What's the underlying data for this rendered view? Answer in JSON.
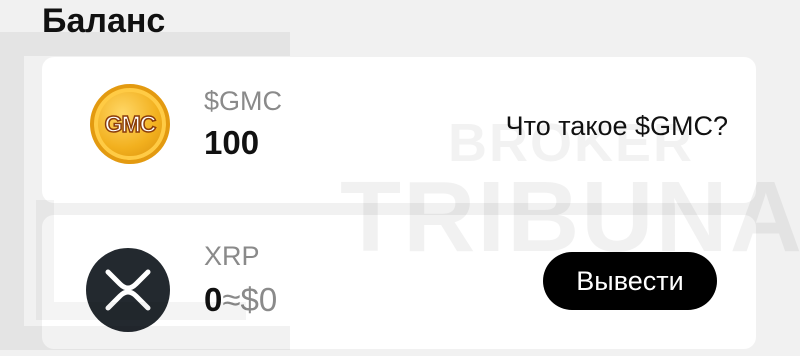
{
  "balance": {
    "title": "Баланс"
  },
  "coins": [
    {
      "icon": "gmc-coin-icon",
      "icon_text": "GMC",
      "name": "$GMC",
      "amount": "100",
      "link_label": "Что такое $GMC?"
    },
    {
      "icon": "xrp-coin-icon",
      "name": "XRP",
      "amount": "0",
      "fiat_value": "≈$0",
      "button_label": "Вывести"
    }
  ],
  "watermark": {
    "line1": "BROKER",
    "line2": "TRIBUNAL"
  },
  "colors": {
    "background": "#f1f1f1",
    "card": "#ffffff",
    "button": "#000000",
    "muted_text": "#8a8a8a",
    "gmc_gold": "#f2b01e",
    "xrp_dark": "#23292f"
  }
}
